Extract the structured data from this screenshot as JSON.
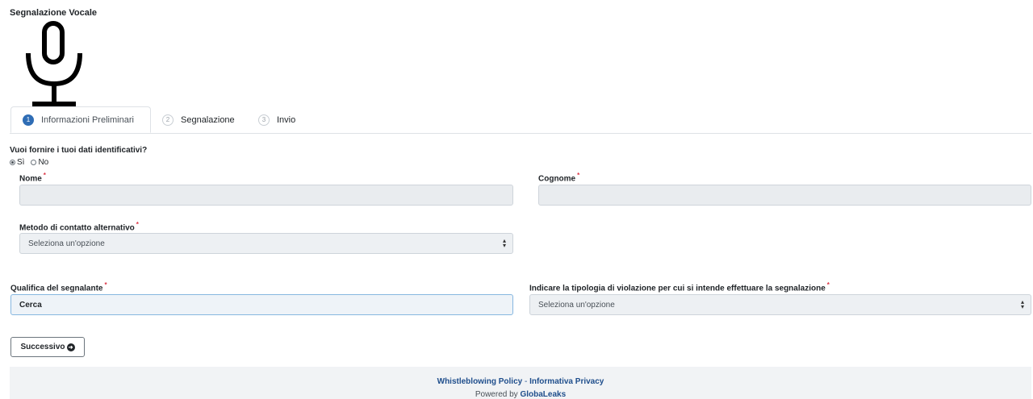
{
  "header": {
    "title": "Segnalazione Vocale",
    "icon": "microphone-icon"
  },
  "tabs": [
    {
      "step": "1",
      "label": "Informazioni Preliminari",
      "active": true
    },
    {
      "step": "2",
      "label": "Segnalazione",
      "active": false
    },
    {
      "step": "3",
      "label": "Invio",
      "active": false
    }
  ],
  "identity": {
    "question": "Vuoi fornire i tuoi dati identificativi?",
    "options": [
      "Sì",
      "No"
    ],
    "selected": "Sì"
  },
  "fields": {
    "nome": {
      "label": "Nome",
      "required_mark": "*",
      "value": ""
    },
    "cognome": {
      "label": "Cognome",
      "required_mark": "*",
      "value": ""
    },
    "contatto": {
      "label": "Metodo di contatto alternativo",
      "required_mark": "*",
      "value": "Seleziona un'opzione"
    },
    "qualifica": {
      "label": "Qualifica del segnalante",
      "required_mark": "*",
      "value": "Cerca"
    },
    "violazione": {
      "label": "Indicare la tipologia di violazione per cui si intende effettuare la segnalazione",
      "required_mark": "*",
      "value": "Seleziona un'opzione"
    }
  },
  "actions": {
    "next_label": "Successivo"
  },
  "footer": {
    "link1": "Whistleblowing Policy",
    "separator": "-",
    "link2": "Informativa Privacy",
    "powered_prefix": "Powered by",
    "powered_brand": "GlobaLeaks"
  },
  "colors": {
    "accent": "#2f6db5",
    "required": "#dc3545",
    "footer_link": "#1f4e8c"
  }
}
